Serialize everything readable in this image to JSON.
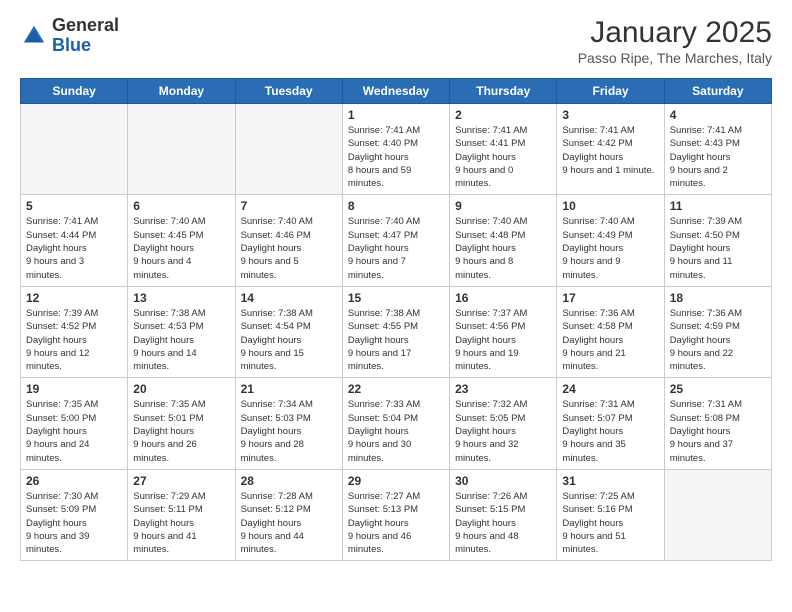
{
  "header": {
    "logo_general": "General",
    "logo_blue": "Blue",
    "month_title": "January 2025",
    "subtitle": "Passo Ripe, The Marches, Italy"
  },
  "weekdays": [
    "Sunday",
    "Monday",
    "Tuesday",
    "Wednesday",
    "Thursday",
    "Friday",
    "Saturday"
  ],
  "weeks": [
    [
      {
        "day": "",
        "empty": true
      },
      {
        "day": "",
        "empty": true
      },
      {
        "day": "",
        "empty": true
      },
      {
        "day": "1",
        "sunrise": "7:41 AM",
        "sunset": "4:40 PM",
        "daylight": "8 hours and 59 minutes."
      },
      {
        "day": "2",
        "sunrise": "7:41 AM",
        "sunset": "4:41 PM",
        "daylight": "9 hours and 0 minutes."
      },
      {
        "day": "3",
        "sunrise": "7:41 AM",
        "sunset": "4:42 PM",
        "daylight": "9 hours and 1 minute."
      },
      {
        "day": "4",
        "sunrise": "7:41 AM",
        "sunset": "4:43 PM",
        "daylight": "9 hours and 2 minutes."
      }
    ],
    [
      {
        "day": "5",
        "sunrise": "7:41 AM",
        "sunset": "4:44 PM",
        "daylight": "9 hours and 3 minutes."
      },
      {
        "day": "6",
        "sunrise": "7:40 AM",
        "sunset": "4:45 PM",
        "daylight": "9 hours and 4 minutes."
      },
      {
        "day": "7",
        "sunrise": "7:40 AM",
        "sunset": "4:46 PM",
        "daylight": "9 hours and 5 minutes."
      },
      {
        "day": "8",
        "sunrise": "7:40 AM",
        "sunset": "4:47 PM",
        "daylight": "9 hours and 7 minutes."
      },
      {
        "day": "9",
        "sunrise": "7:40 AM",
        "sunset": "4:48 PM",
        "daylight": "9 hours and 8 minutes."
      },
      {
        "day": "10",
        "sunrise": "7:40 AM",
        "sunset": "4:49 PM",
        "daylight": "9 hours and 9 minutes."
      },
      {
        "day": "11",
        "sunrise": "7:39 AM",
        "sunset": "4:50 PM",
        "daylight": "9 hours and 11 minutes."
      }
    ],
    [
      {
        "day": "12",
        "sunrise": "7:39 AM",
        "sunset": "4:52 PM",
        "daylight": "9 hours and 12 minutes."
      },
      {
        "day": "13",
        "sunrise": "7:38 AM",
        "sunset": "4:53 PM",
        "daylight": "9 hours and 14 minutes."
      },
      {
        "day": "14",
        "sunrise": "7:38 AM",
        "sunset": "4:54 PM",
        "daylight": "9 hours and 15 minutes."
      },
      {
        "day": "15",
        "sunrise": "7:38 AM",
        "sunset": "4:55 PM",
        "daylight": "9 hours and 17 minutes."
      },
      {
        "day": "16",
        "sunrise": "7:37 AM",
        "sunset": "4:56 PM",
        "daylight": "9 hours and 19 minutes."
      },
      {
        "day": "17",
        "sunrise": "7:36 AM",
        "sunset": "4:58 PM",
        "daylight": "9 hours and 21 minutes."
      },
      {
        "day": "18",
        "sunrise": "7:36 AM",
        "sunset": "4:59 PM",
        "daylight": "9 hours and 22 minutes."
      }
    ],
    [
      {
        "day": "19",
        "sunrise": "7:35 AM",
        "sunset": "5:00 PM",
        "daylight": "9 hours and 24 minutes."
      },
      {
        "day": "20",
        "sunrise": "7:35 AM",
        "sunset": "5:01 PM",
        "daylight": "9 hours and 26 minutes."
      },
      {
        "day": "21",
        "sunrise": "7:34 AM",
        "sunset": "5:03 PM",
        "daylight": "9 hours and 28 minutes."
      },
      {
        "day": "22",
        "sunrise": "7:33 AM",
        "sunset": "5:04 PM",
        "daylight": "9 hours and 30 minutes."
      },
      {
        "day": "23",
        "sunrise": "7:32 AM",
        "sunset": "5:05 PM",
        "daylight": "9 hours and 32 minutes."
      },
      {
        "day": "24",
        "sunrise": "7:31 AM",
        "sunset": "5:07 PM",
        "daylight": "9 hours and 35 minutes."
      },
      {
        "day": "25",
        "sunrise": "7:31 AM",
        "sunset": "5:08 PM",
        "daylight": "9 hours and 37 minutes."
      }
    ],
    [
      {
        "day": "26",
        "sunrise": "7:30 AM",
        "sunset": "5:09 PM",
        "daylight": "9 hours and 39 minutes."
      },
      {
        "day": "27",
        "sunrise": "7:29 AM",
        "sunset": "5:11 PM",
        "daylight": "9 hours and 41 minutes."
      },
      {
        "day": "28",
        "sunrise": "7:28 AM",
        "sunset": "5:12 PM",
        "daylight": "9 hours and 44 minutes."
      },
      {
        "day": "29",
        "sunrise": "7:27 AM",
        "sunset": "5:13 PM",
        "daylight": "9 hours and 46 minutes."
      },
      {
        "day": "30",
        "sunrise": "7:26 AM",
        "sunset": "5:15 PM",
        "daylight": "9 hours and 48 minutes."
      },
      {
        "day": "31",
        "sunrise": "7:25 AM",
        "sunset": "5:16 PM",
        "daylight": "9 hours and 51 minutes."
      },
      {
        "day": "",
        "empty": true
      }
    ]
  ]
}
